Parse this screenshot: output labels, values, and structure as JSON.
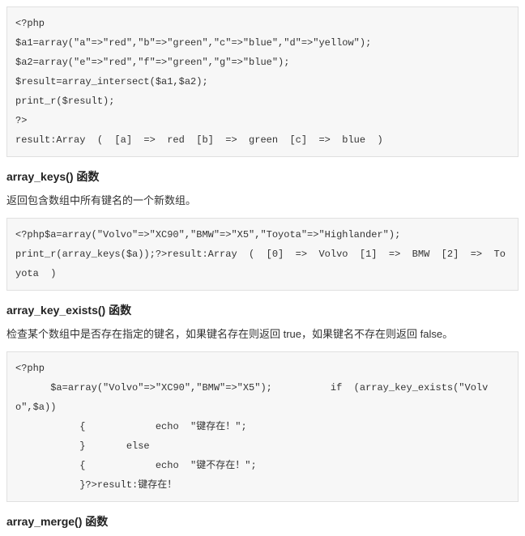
{
  "code1": {
    "l1": "<?php",
    "l2": "$a1=array(\"a\"=>\"red\",\"b\"=>\"green\",\"c\"=>\"blue\",\"d\"=>\"yellow\");",
    "l3": "$a2=array(\"e\"=>\"red\",\"f\"=>\"green\",\"g\"=>\"blue\");",
    "l4": "$result=array_intersect($a1,$a2);",
    "l5": "print_r($result);",
    "l6": "?>",
    "l7": "result:Array  (  [a]  =>  red  [b]  =>  green  [c]  =>  blue  )"
  },
  "section1": {
    "heading": "array_keys() 函数",
    "desc": "返回包含数组中所有键名的一个新数组。"
  },
  "code2": {
    "l1": "<?php$a=array(\"Volvo\"=>\"XC90\",\"BMW\"=>\"X5\",\"Toyota\"=>\"Highlander\");",
    "l2": "print_r(array_keys($a));?>result:Array  (  [0]  =>  Volvo  [1]  =>  BMW  [2]  =>  Toyota  )"
  },
  "section2": {
    "heading": "array_key_exists() 函数",
    "desc": "检查某个数组中是否存在指定的键名，如果键名存在则返回 true，如果键名不存在则返回 false。"
  },
  "code3": {
    "l1": "<?php",
    "l2": "      $a=array(\"Volvo\"=>\"XC90\",\"BMW\"=>\"X5\");          if  (array_key_exists(\"Volvo\",$a))",
    "l3": "           {            echo  \"键存在！\";",
    "l4": "           }       else",
    "l5": "           {            echo  \"键不存在！\";",
    "l6": "           }?>result:键存在！"
  },
  "section3": {
    "heading": "array_merge() 函数"
  }
}
